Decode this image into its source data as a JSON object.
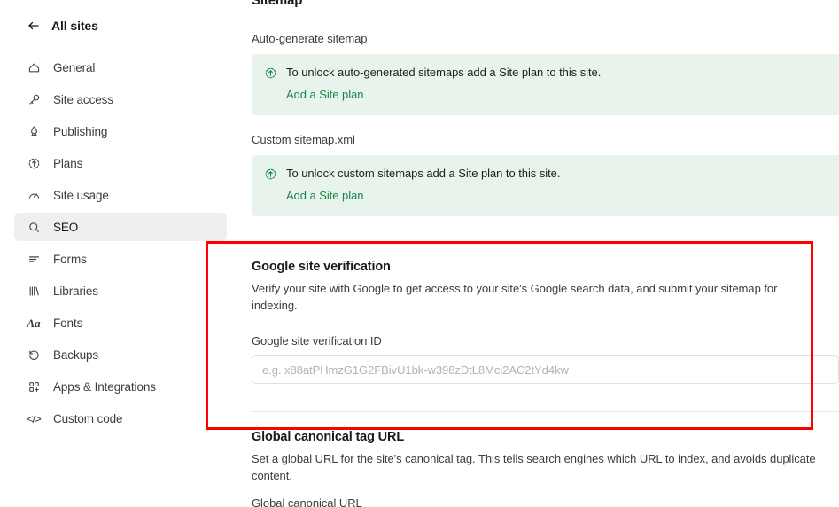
{
  "sidebar": {
    "back": {
      "label": "All sites",
      "icon": "arrow-left-icon"
    },
    "items": [
      {
        "label": "General",
        "icon": "home-icon",
        "active": false
      },
      {
        "label": "Site access",
        "icon": "key-icon",
        "active": false
      },
      {
        "label": "Publishing",
        "icon": "rocket-icon",
        "active": false
      },
      {
        "label": "Plans",
        "icon": "upgrade-icon",
        "active": false
      },
      {
        "label": "Site usage",
        "icon": "gauge-icon",
        "active": false
      },
      {
        "label": "SEO",
        "icon": "search-icon",
        "active": true
      },
      {
        "label": "Forms",
        "icon": "form-lines-icon",
        "active": false
      },
      {
        "label": "Libraries",
        "icon": "libraries-icon",
        "active": false
      },
      {
        "label": "Fonts",
        "icon": "fonts-aa-icon",
        "active": false
      },
      {
        "label": "Backups",
        "icon": "restore-icon",
        "active": false
      },
      {
        "label": "Apps & Integrations",
        "icon": "apps-grid-icon",
        "active": false
      },
      {
        "label": "Custom code",
        "icon": "code-brackets-icon",
        "active": false
      }
    ]
  },
  "main": {
    "sitemap": {
      "title": "Sitemap",
      "auto_generate_label": "Auto-generate sitemap",
      "auto_generate_banner": {
        "icon": "upgrade-icon",
        "text": "To unlock auto-generated sitemaps add a Site plan to this site.",
        "link": "Add a Site plan"
      },
      "custom_label": "Custom sitemap.xml",
      "custom_banner": {
        "icon": "upgrade-icon",
        "text": "To unlock custom sitemaps add a Site plan to this site.",
        "link": "Add a Site plan"
      }
    },
    "google_verification": {
      "heading": "Google site verification",
      "description": "Verify your site with Google to get access to your site's Google search data, and submit your sitemap for indexing.",
      "field_label": "Google site verification ID",
      "field_value": "",
      "field_placeholder": "e.g. x88atPHmzG1G2FBivU1bk-w398zDtL8Mci2AC2tYd4kw"
    },
    "canonical": {
      "heading": "Global canonical tag URL",
      "description": "Set a global URL for the site's canonical tag. This tells search engines which URL to index, and avoids duplicate content.",
      "field_label": "Global canonical URL"
    }
  },
  "annotation": {
    "highlight_color": "#ff0000"
  },
  "colors": {
    "accent_green": "#17864a",
    "banner_bg": "#e8f3ec",
    "active_nav_bg": "#efefef",
    "text_primary": "#1a1a1a",
    "text_secondary": "#3d3d3d",
    "placeholder": "#b3b3b3"
  }
}
